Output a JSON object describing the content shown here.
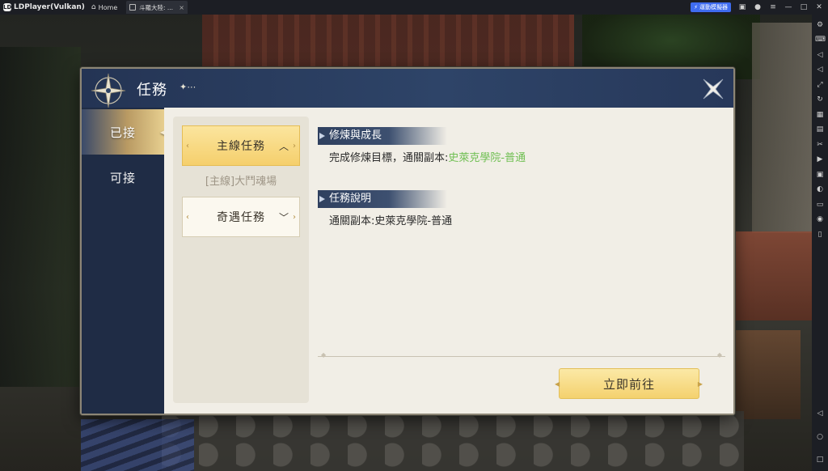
{
  "emulator": {
    "app_title": "LDPlayer(Vulkan)",
    "home_label": "Home",
    "tab_title": "斗羅大陸: ...",
    "badge_label": "運動模擬器"
  },
  "dialog": {
    "title": "任務",
    "title_deco": "✦⋯",
    "tabs": [
      {
        "label": "已接",
        "active": true
      },
      {
        "label": "可接",
        "active": false
      }
    ],
    "categories": {
      "main": {
        "label": "主線任務",
        "expanded": true
      },
      "entry": "[主線]大鬥魂場",
      "encounter": {
        "label": "奇遇任務",
        "expanded": false
      }
    },
    "sections": {
      "growth": {
        "heading": "修煉與成長",
        "text_prefix": "完成修煉目標，通關副本:",
        "text_highlight": "史萊克學院-普通"
      },
      "description": {
        "heading": "任務說明",
        "text": "通關副本:史萊克學院-普通"
      }
    },
    "go_button": "立即前往"
  },
  "colors": {
    "header": "#2e4468",
    "content_bg": "#f1eee6",
    "gold_button": "#f4d16e",
    "highlight_green": "#6fbf52"
  }
}
